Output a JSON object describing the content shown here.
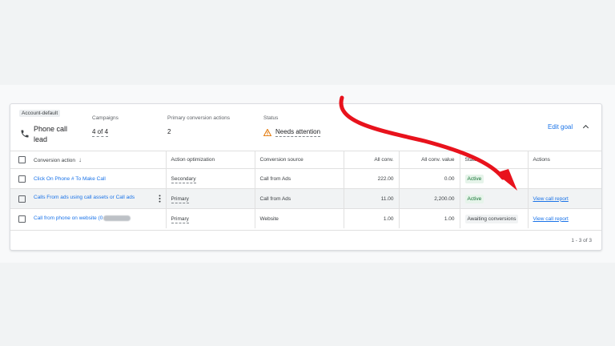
{
  "summary": {
    "chip": "Account-default",
    "goal_name": "Phone call lead",
    "campaigns_label": "Campaigns",
    "campaigns_value": "4 of 4",
    "primary_label": "Primary conversion actions",
    "primary_value": "2",
    "status_label": "Status",
    "status_value": "Needs attention",
    "edit_goal": "Edit goal"
  },
  "table": {
    "headers": {
      "action": "Conversion action",
      "optimization": "Action optimization",
      "source": "Conversion source",
      "all_conv": "All conv.",
      "all_conv_value": "All conv. value",
      "status": "Status",
      "actions": "Actions"
    },
    "rows": [
      {
        "action": "Click On Phone # To Make Call",
        "optimization": "Secondary",
        "source": "Call from Ads",
        "all_conv": "222.00",
        "all_conv_value": "0.00",
        "status": "Active",
        "link": ""
      },
      {
        "action": "Calls From ads using call assets or Call ads",
        "optimization": "Primary",
        "source": "Call from Ads",
        "all_conv": "11.00",
        "all_conv_value": "2,200.00",
        "status": "Active",
        "link": "View call report"
      },
      {
        "action": "Call from phone on website (0",
        "optimization": "Primary",
        "source": "Website",
        "all_conv": "1.00",
        "all_conv_value": "1.00",
        "status": "Awaiting conversions",
        "link": "View call report"
      }
    ]
  },
  "footer": {
    "pagination": "1 - 3 of 3"
  },
  "colors": {
    "link": "#1a73e8",
    "active_bg": "#e6f4ea",
    "active_text": "#137333",
    "warning": "#e37400",
    "annotation_arrow": "#e8121c"
  }
}
